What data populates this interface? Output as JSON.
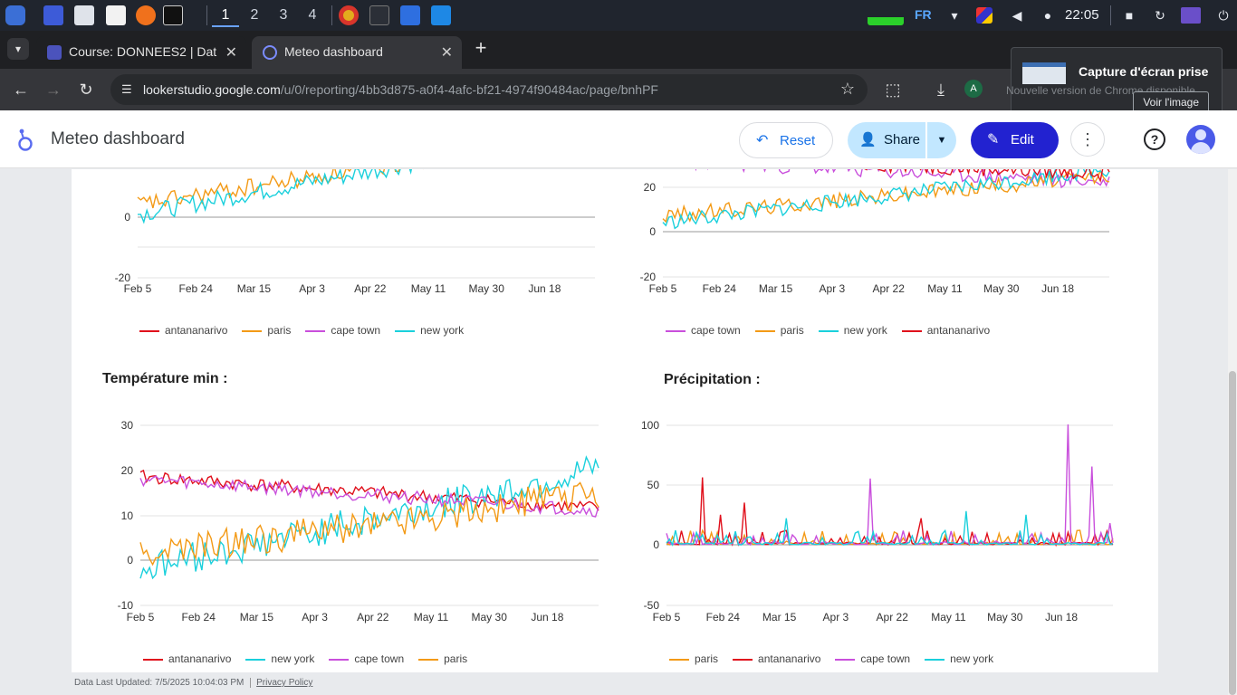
{
  "taskbar": {
    "workspaces": [
      "1",
      "2",
      "3",
      "4"
    ],
    "lang": "FR",
    "clock": "22:05"
  },
  "tabs": [
    {
      "title": "Course: DONNEES2 | Dat",
      "active": false
    },
    {
      "title": "Meteo dashboard",
      "active": true
    }
  ],
  "address": {
    "host": "lookerstudio.google.com",
    "path": "/u/0/reporting/4bb3d875-a0f4-4afc-bf21-4974f90484ac/page/bnhPF",
    "profile_initial": "A"
  },
  "notification": {
    "title": "Capture d'écran prise",
    "subtitle": "Nouvelle version de Chrome disponible",
    "button": "Voir l'image"
  },
  "header": {
    "title": "Meteo dashboard",
    "reset": "Reset",
    "share": "Share",
    "edit": "Edit"
  },
  "charts": {
    "xticks": [
      "Feb 5",
      "Feb 24",
      "Mar 15",
      "Apr 3",
      "Apr 22",
      "May 11",
      "May 30",
      "Jun 18"
    ],
    "colors": {
      "antananarivo": "#e0101c",
      "paris": "#f39a16",
      "cape town": "#c94fdc",
      "new york": "#1ad0dc"
    },
    "top_left": {
      "yticks": [
        "0",
        "-20"
      ],
      "legend": [
        "antananarivo",
        "paris",
        "cape town",
        "new york"
      ]
    },
    "top_right": {
      "yticks": [
        "20",
        "0",
        "-20"
      ],
      "legend": [
        "cape town",
        "paris",
        "new york",
        "antananarivo"
      ]
    },
    "bottom_left": {
      "title": "Température min :",
      "yticks": [
        "30",
        "20",
        "10",
        "0",
        "-10"
      ],
      "legend": [
        "antananarivo",
        "new york",
        "cape town",
        "paris"
      ]
    },
    "bottom_right": {
      "title": "Précipitation :",
      "yticks": [
        "100",
        "50",
        "0",
        "-50"
      ],
      "legend": [
        "paris",
        "antananarivo",
        "cape town",
        "new york"
      ]
    }
  },
  "footer": {
    "updated": "Data Last Updated: 7/5/2025 10:04:03 PM",
    "privacy": "Privacy Policy"
  }
}
